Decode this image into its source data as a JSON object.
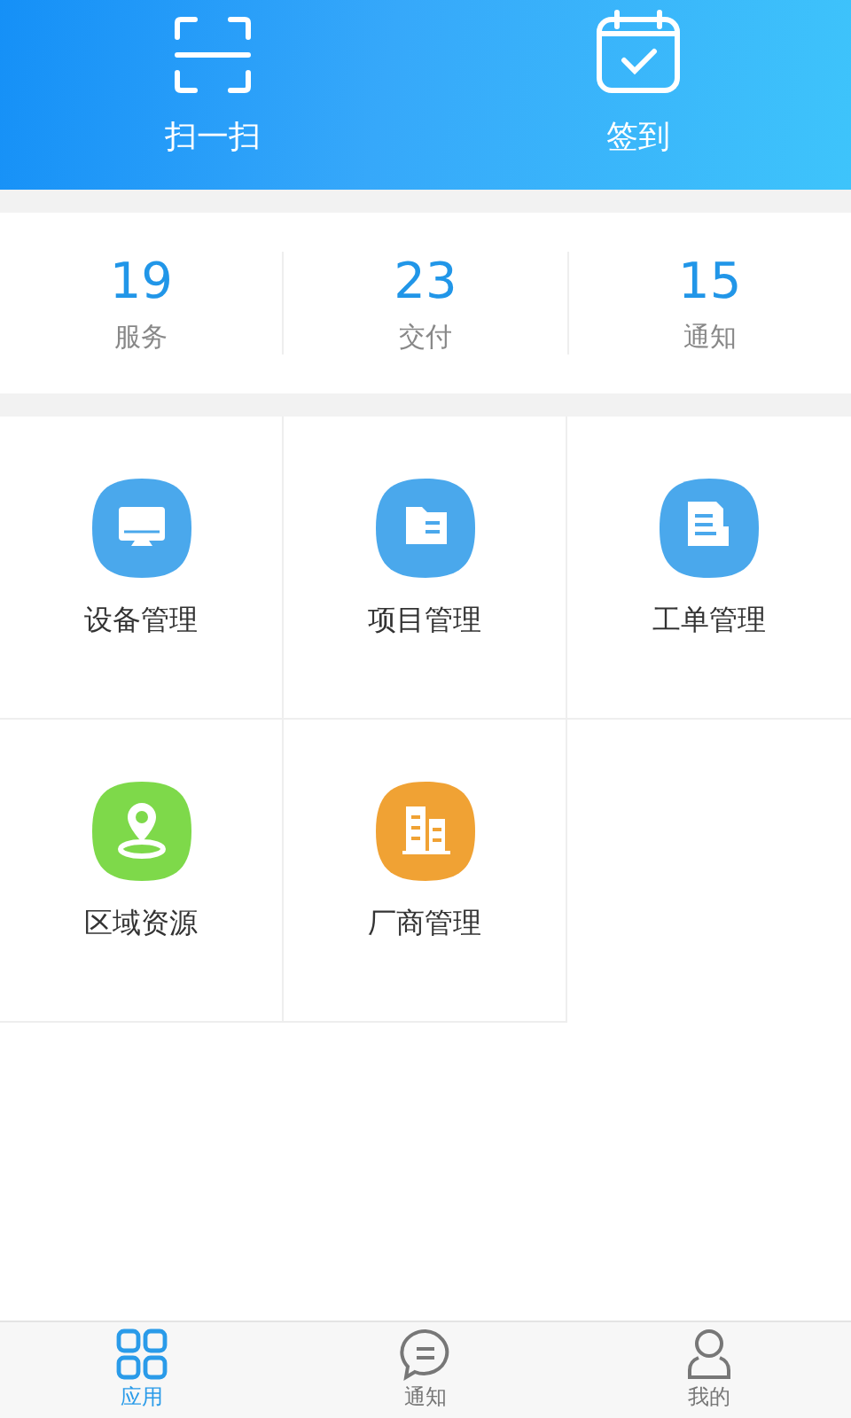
{
  "header_actions": [
    {
      "kind": "scan",
      "label": "扫一扫"
    },
    {
      "kind": "checkin",
      "label": "签到"
    }
  ],
  "stats": [
    {
      "value": "19",
      "label": "服务"
    },
    {
      "value": "23",
      "label": "交付"
    },
    {
      "value": "15",
      "label": "通知"
    }
  ],
  "apps": [
    {
      "kind": "monitor",
      "label": "设备管理",
      "color": "#4aa8ec"
    },
    {
      "kind": "folder",
      "label": "项目管理",
      "color": "#4aa8ec"
    },
    {
      "kind": "document",
      "label": "工单管理",
      "color": "#4aa8ec"
    },
    {
      "kind": "location",
      "label": "区域资源",
      "color": "#7ed94a"
    },
    {
      "kind": "building",
      "label": "厂商管理",
      "color": "#f0a234"
    }
  ],
  "tabs": [
    {
      "kind": "grid",
      "label": "应用",
      "selected": true
    },
    {
      "kind": "chat",
      "label": "通知",
      "selected": false
    },
    {
      "kind": "person",
      "label": "我的",
      "selected": false
    }
  ]
}
